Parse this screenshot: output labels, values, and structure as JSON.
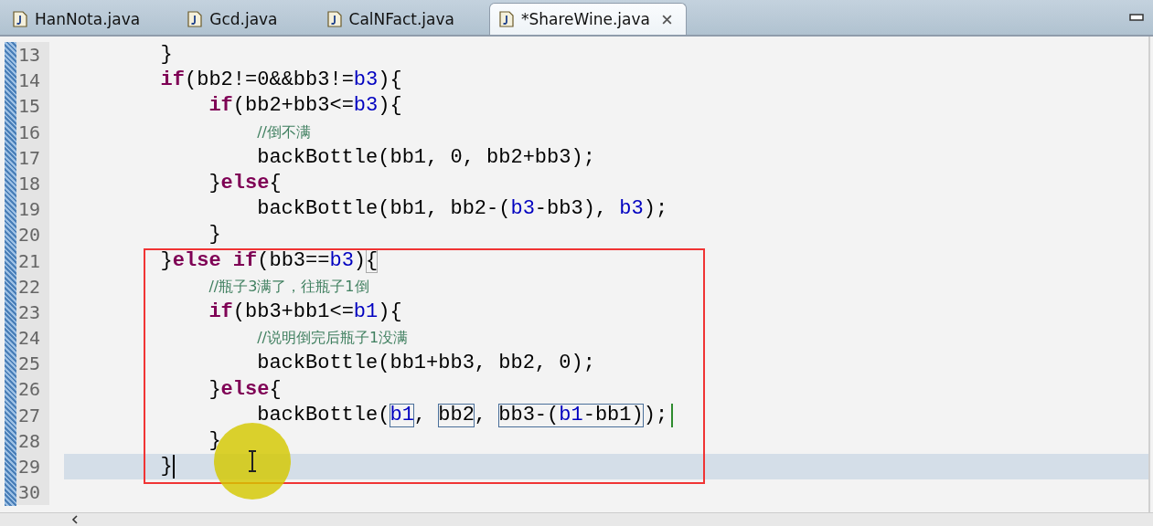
{
  "tabs": [
    {
      "label": "HanNota.java",
      "selected": false
    },
    {
      "label": "Gcd.java",
      "selected": false
    },
    {
      "label": "CalNFact.java",
      "selected": false
    },
    {
      "label": "*ShareWine.java",
      "selected": true
    }
  ],
  "editor": {
    "lines": [
      {
        "number": "13",
        "current": false,
        "segments": [
          {
            "kind": "text",
            "text": "\t\t}"
          }
        ]
      },
      {
        "number": "14",
        "current": false,
        "segments": [
          {
            "kind": "keyword",
            "text": "\t\tif"
          },
          {
            "kind": "text",
            "text": "(bb2!=0&&bb3!="
          },
          {
            "kind": "field",
            "text": "b3"
          },
          {
            "kind": "text",
            "text": "){"
          }
        ]
      },
      {
        "number": "15",
        "current": false,
        "segments": [
          {
            "kind": "keyword",
            "text": "\t\t\tif"
          },
          {
            "kind": "text",
            "text": "(bb2+bb3<="
          },
          {
            "kind": "field",
            "text": "b3"
          },
          {
            "kind": "text",
            "text": "){"
          }
        ]
      },
      {
        "number": "16",
        "current": false,
        "segments": [
          {
            "kind": "comment",
            "text": "\t\t\t\t//倒不满"
          }
        ]
      },
      {
        "number": "17",
        "current": false,
        "segments": [
          {
            "kind": "text",
            "text": "\t\t\t\tbackBottle(bb1, 0, bb2+bb3);"
          }
        ]
      },
      {
        "number": "18",
        "current": false,
        "segments": [
          {
            "kind": "text",
            "text": "\t\t\t}"
          },
          {
            "kind": "keyword",
            "text": "else"
          },
          {
            "kind": "text",
            "text": "{"
          }
        ]
      },
      {
        "number": "19",
        "current": false,
        "segments": [
          {
            "kind": "text",
            "text": "\t\t\t\tbackBottle(bb1, bb2-("
          },
          {
            "kind": "field",
            "text": "b3"
          },
          {
            "kind": "text",
            "text": "-bb3), "
          },
          {
            "kind": "field",
            "text": "b3"
          },
          {
            "kind": "text",
            "text": ");"
          }
        ]
      },
      {
        "number": "20",
        "current": false,
        "segments": [
          {
            "kind": "text",
            "text": "\t\t\t}"
          }
        ]
      },
      {
        "number": "21",
        "current": false,
        "segments": [
          {
            "kind": "text",
            "text": "\t\t}"
          },
          {
            "kind": "keyword",
            "text": "else if"
          },
          {
            "kind": "text",
            "text": "(bb3=="
          },
          {
            "kind": "field",
            "text": "b3"
          },
          {
            "kind": "text",
            "text": ")"
          },
          {
            "kind": "bracket",
            "text": "{"
          }
        ]
      },
      {
        "number": "22",
        "current": false,
        "segments": [
          {
            "kind": "comment",
            "text": "\t\t\t//瓶子3满了，往瓶子1倒"
          }
        ]
      },
      {
        "number": "23",
        "current": false,
        "segments": [
          {
            "kind": "keyword",
            "text": "\t\t\tif"
          },
          {
            "kind": "text",
            "text": "(bb3+bb1<="
          },
          {
            "kind": "field",
            "text": "b1"
          },
          {
            "kind": "text",
            "text": "){"
          }
        ]
      },
      {
        "number": "24",
        "current": false,
        "segments": [
          {
            "kind": "comment",
            "text": "\t\t\t\t//说明倒完后瓶子1没满"
          }
        ]
      },
      {
        "number": "25",
        "current": false,
        "segments": [
          {
            "kind": "text",
            "text": "\t\t\t\tbackBottle(bb1+bb3, bb2, 0);"
          }
        ]
      },
      {
        "number": "26",
        "current": false,
        "segments": [
          {
            "kind": "text",
            "text": "\t\t\t}"
          },
          {
            "kind": "keyword",
            "text": "else"
          },
          {
            "kind": "text",
            "text": "{"
          }
        ]
      },
      {
        "number": "27",
        "current": false,
        "segments": [
          {
            "kind": "text",
            "text": "\t\t\t\tbackBottle("
          },
          {
            "kind": "linked",
            "parts": [
              {
                "kind": "field",
                "text": "b1"
              }
            ]
          },
          {
            "kind": "text",
            "text": ", "
          },
          {
            "kind": "linked",
            "parts": [
              {
                "kind": "text",
                "text": "bb2"
              }
            ]
          },
          {
            "kind": "text",
            "text": ", "
          },
          {
            "kind": "linked",
            "parts": [
              {
                "kind": "text",
                "text": "bb3-("
              },
              {
                "kind": "field",
                "text": "b1"
              },
              {
                "kind": "text",
                "text": "-bb1)"
              }
            ]
          },
          {
            "kind": "text",
            "text": ");"
          },
          {
            "kind": "edit-caret"
          }
        ]
      },
      {
        "number": "28",
        "current": false,
        "segments": [
          {
            "kind": "text",
            "text": "\t\t\t}"
          }
        ]
      },
      {
        "number": "29",
        "current": true,
        "segments": [
          {
            "kind": "text",
            "text": "\t\t}"
          },
          {
            "kind": "caret"
          }
        ]
      },
      {
        "number": "30",
        "current": false
      }
    ]
  }
}
